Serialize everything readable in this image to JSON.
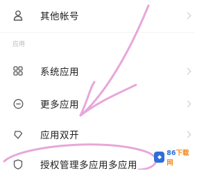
{
  "settings": {
    "items": [
      {
        "label": "其他帐号",
        "icon": "person-icon"
      },
      {
        "label": "系统应用",
        "icon": "grid-icon"
      },
      {
        "label": "更多应用",
        "icon": "minus-circle-icon"
      },
      {
        "label": "应用双开",
        "icon": "clone-icon"
      },
      {
        "label": "授权管理多应用多应用",
        "icon": "shield-icon"
      }
    ],
    "section_label": "应用"
  },
  "watermark": {
    "text_primary": "86",
    "text_secondary": "下载网"
  },
  "colors": {
    "annotation": "#e6a6d8",
    "chevron": "#c8c8c8",
    "brand": "#2f6fd6"
  }
}
